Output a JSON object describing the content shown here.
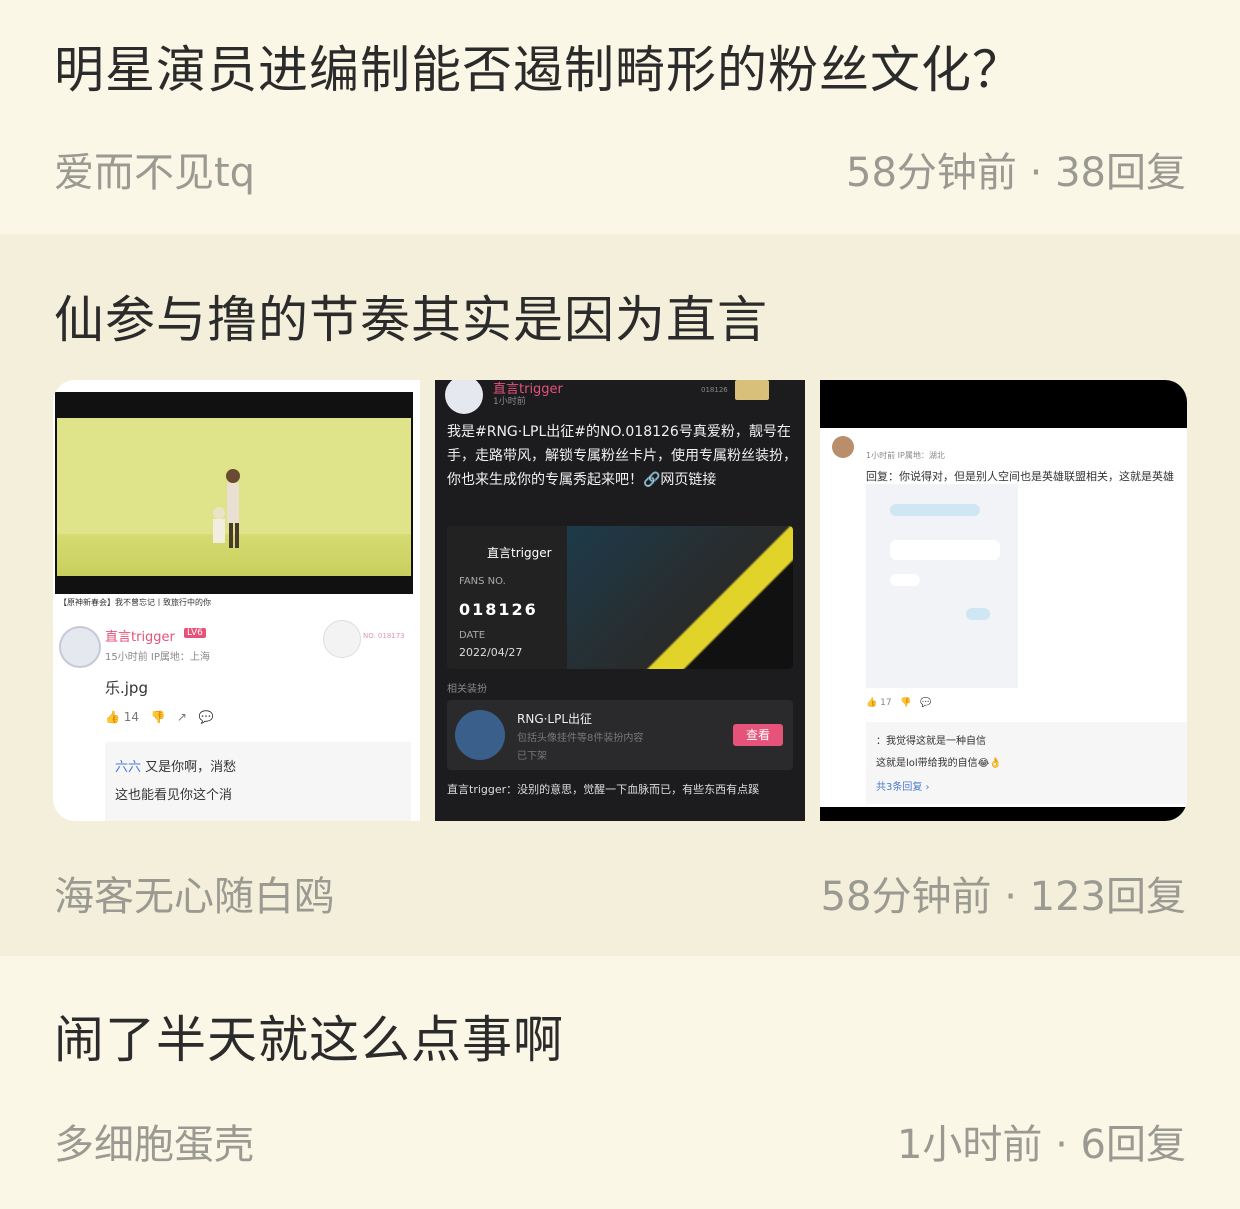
{
  "posts": [
    {
      "title": "明星演员进编制能否遏制畸形的粉丝文化？",
      "author": "爱而不见tq",
      "time": "58分钟前",
      "replies": "38回复"
    },
    {
      "title": "仙参与撸的节奏其实是因为直言",
      "author": "海客无心随白鸥",
      "time": "58分钟前",
      "replies": "123回复",
      "thumbs": {
        "t1": {
          "caption": "【原神新春会】我不曾忘记丨致旅行中的你",
          "username": "直言trigger",
          "level": "LV6",
          "sub": "15小时前  IP属地：上海",
          "no": "NO. 018173",
          "body": "乐.jpg",
          "likes": "14",
          "reply1_name": "六六",
          "reply1_text": "又是你啊，消愁",
          "reply2_text": "这也能看见你这个消"
        },
        "t2": {
          "username": "直言trigger",
          "time": "1小时前",
          "num": "018126",
          "text": "我是#RNG·LPL出征#的NO.018126号真爱粉，靓号在手，走路带风，解锁专属粉丝卡片，使用专属粉丝装扮，你也来生成你的专属秀起来吧！🔗网页链接",
          "card_name": "直言trigger",
          "fans_label": "FANS NO.",
          "fans_no": "018126",
          "date_label": "DATE",
          "date": "2022/04/27",
          "related": "相关装扮",
          "item_name": "RNG·LPL出征",
          "item_desc": "包括头像挂件等8件装扮内容",
          "item_desc2": "已下架",
          "item_btn": "查看",
          "comment": "直言trigger：没别的意思，觉醒一下血脉而已，有些东西有点蹊"
        },
        "t3": {
          "time": "1小时前  IP属地：湖北",
          "quote": "回复：你说得对，但是别人空间也是英雄联盟相关，这就是英雄",
          "likes": "17",
          "reply1": "：我觉得这就是一种自信",
          "reply2": "这就是lol带给我的自信😂👌",
          "more": "共3条回复 ›"
        }
      }
    },
    {
      "title": "闹了半天就这么点事啊",
      "author": "多细胞蛋壳",
      "time": "1小时前",
      "replies": "6回复"
    }
  ]
}
